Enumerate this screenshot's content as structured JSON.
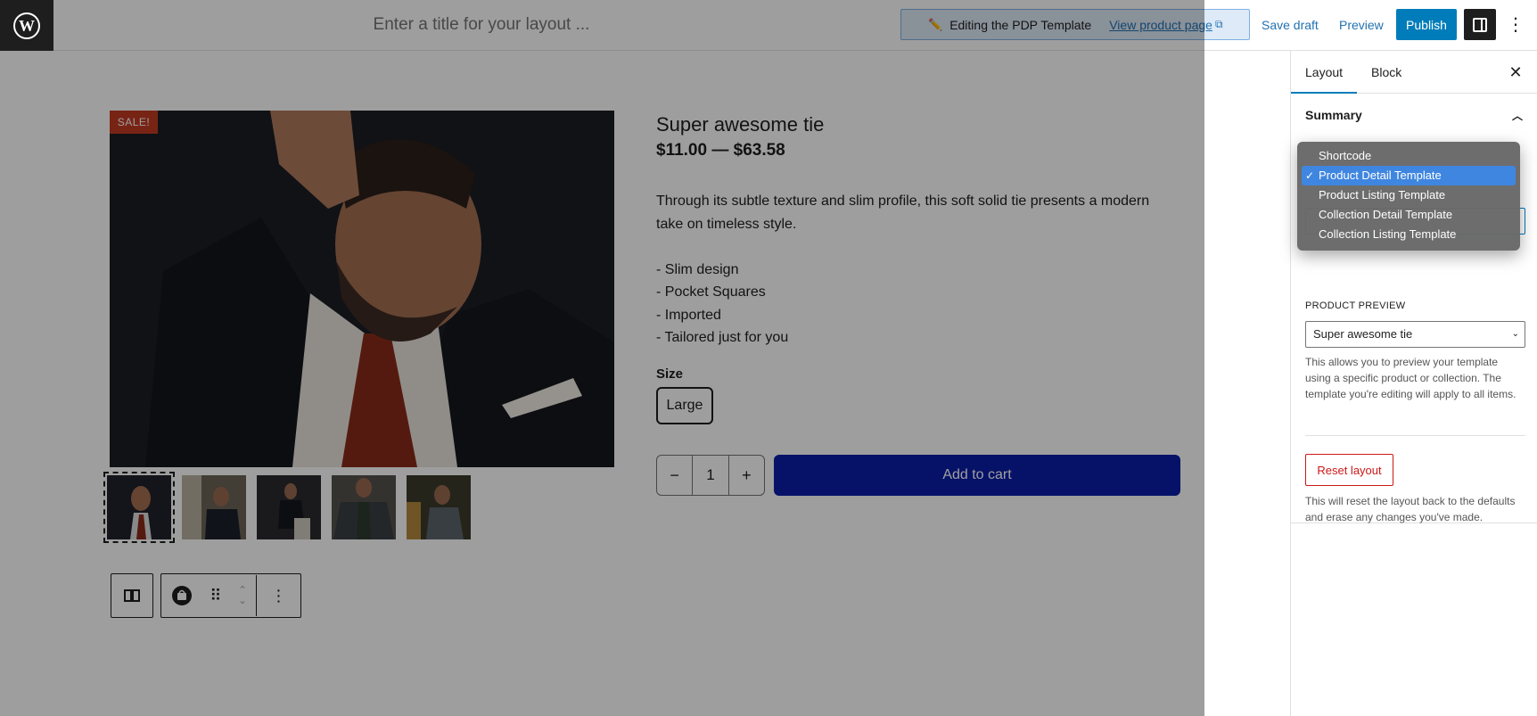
{
  "header": {
    "title_placeholder": "Enter a title for your layout ...",
    "editing_label": "Editing the PDP Template",
    "view_link": "View product page",
    "save_draft": "Save draft",
    "preview": "Preview",
    "publish": "Publish"
  },
  "product": {
    "sale_badge": "SALE!",
    "title": "Super awesome tie",
    "price": "$11.00 — $63.58",
    "description": "Through its subtle texture and slim profile, this soft solid tie presents a modern take on timeless style.\n\n- Slim design\n- Pocket Squares\n- Imported\n- Tailored just for you",
    "size_label": "Size",
    "size_option": "Large",
    "quantity": "1",
    "qty_minus": "−",
    "qty_plus": "+",
    "add_to_cart": "Add to cart"
  },
  "sidebar": {
    "tabs": [
      {
        "label": "Layout"
      },
      {
        "label": "Block"
      }
    ],
    "summary_title": "Summary",
    "template_options": [
      {
        "label": "Shortcode"
      },
      {
        "label": "Product Detail Template"
      },
      {
        "label": "Product Listing Template"
      },
      {
        "label": "Collection Detail Template"
      },
      {
        "label": "Collection Listing Template"
      }
    ],
    "selected_template": "Product Detail Template",
    "product_preview_label": "PRODUCT PREVIEW",
    "product_preview_value": "Super awesome tie",
    "preview_help": "This allows you to preview your template using a specific product or collection. The template you're editing will apply to all items.",
    "reset_label": "Reset layout",
    "reset_help": "This will reset the layout back to the defaults and erase any changes you've made."
  },
  "colors": {
    "accent": "#007cba",
    "add_to_cart": "#0b1ea8",
    "sale": "#c23b23",
    "danger": "#cc1818"
  }
}
